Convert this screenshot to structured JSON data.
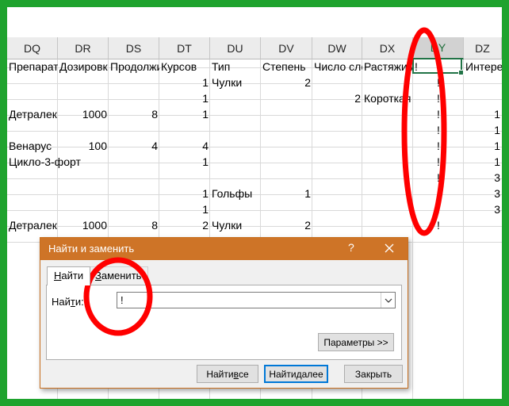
{
  "spreadsheet": {
    "columns": [
      "DQ",
      "DR",
      "DS",
      "DT",
      "DU",
      "DV",
      "DW",
      "DX",
      "DY",
      "DZ"
    ],
    "header_row": [
      "Препарат",
      "Дозировк",
      "Продолжи",
      "Курсов",
      "Тип",
      "Степень",
      "Число сло",
      "Растяжим",
      "!",
      "Интере"
    ],
    "rows": [
      [
        "",
        "",
        "",
        "1",
        "Чулки",
        "2",
        "",
        "",
        "!",
        ""
      ],
      [
        "",
        "",
        "",
        "1",
        "",
        "",
        "2",
        "Короткая",
        "!",
        ""
      ],
      [
        "Детралек",
        "1000",
        "8",
        "1",
        "",
        "",
        "",
        "",
        "!",
        "1"
      ],
      [
        "",
        "",
        "",
        "",
        "",
        "",
        "",
        "",
        "!",
        "1"
      ],
      [
        "Венарус",
        "100",
        "4",
        "4",
        "",
        "",
        "",
        "",
        "!",
        "1"
      ],
      [
        "Цикло-3-форт",
        "",
        "",
        "1",
        "",
        "",
        "",
        "",
        "!",
        "1"
      ],
      [
        "",
        "",
        "",
        "",
        "",
        "",
        "",
        "",
        "!",
        "3"
      ],
      [
        "",
        "",
        "",
        "1",
        "Гольфы",
        "1",
        "",
        "",
        "!",
        "3"
      ],
      [
        "",
        "",
        "",
        "1",
        "",
        "",
        "",
        "",
        "!",
        "3"
      ],
      [
        "Детралек",
        "1000",
        "8",
        "2",
        "Чулки",
        "2",
        "",
        "",
        "!",
        ""
      ]
    ]
  },
  "dialog": {
    "title": "Найти и заменить",
    "help_label": "?",
    "tabs": [
      {
        "pre": "",
        "key": "Н",
        "post": "айти"
      },
      {
        "pre": "",
        "key": "З",
        "post": "аменить"
      }
    ],
    "find_label_pre": "Най",
    "find_label_key": "т",
    "find_label_post": "и:",
    "find_value": "!",
    "options_button": "Параметры >>",
    "find_all_pre": "Найти ",
    "find_all_key": "в",
    "find_all_post": "се",
    "find_next_pre": "Найти ",
    "find_next_key": "д",
    "find_next_post": "алее",
    "close_button": "Закрыть"
  },
  "colors": {
    "frame": "#1fa32e",
    "dialog_title_bar": "#ce7427",
    "annotation": "#ff0000",
    "selection": "#217346"
  },
  "icons": [
    "close-icon",
    "dropdown-arrow-icon",
    "fill-handle-icon"
  ]
}
